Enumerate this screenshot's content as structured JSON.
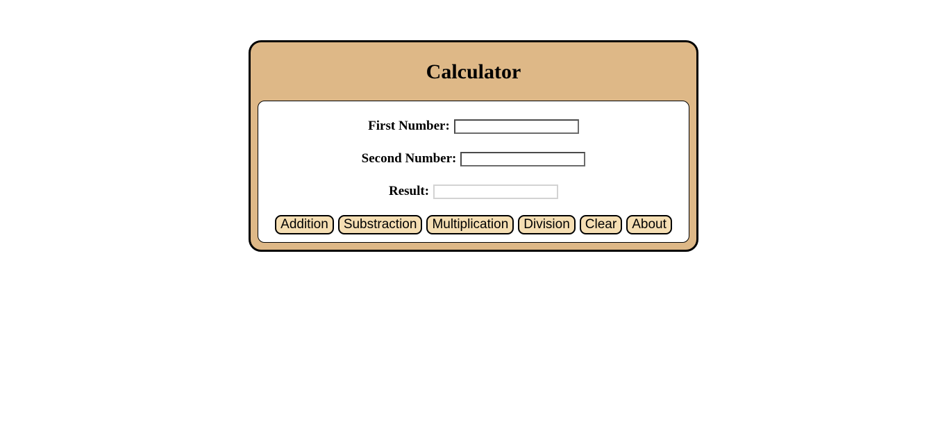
{
  "calculator": {
    "title": "Calculator",
    "first_number": {
      "label": "First Number:",
      "value": ""
    },
    "second_number": {
      "label": "Second Number:",
      "value": ""
    },
    "result": {
      "label": "Result:",
      "value": ""
    },
    "buttons": {
      "addition": "Addition",
      "subtraction": "Substraction",
      "multiplication": "Multiplication",
      "division": "Division",
      "clear": "Clear",
      "about": "About"
    }
  },
  "colors": {
    "frame_background": "#deb887",
    "button_background": "#f5deb3",
    "panel_background": "#ffffff",
    "border": "#000000"
  }
}
